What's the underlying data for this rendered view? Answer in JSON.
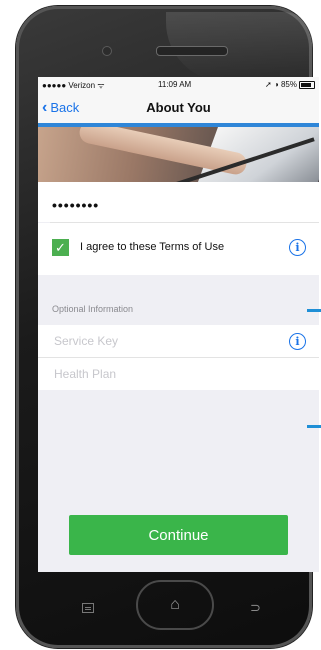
{
  "status_bar": {
    "carrier": "●●●●● Verizon ᯤ",
    "time": "11:09 AM",
    "battery": "85%"
  },
  "nav": {
    "back_label": "Back",
    "title": "About You"
  },
  "form": {
    "password_value": "••••••••",
    "terms_label": "I agree to these Terms of Use",
    "terms_checked": true,
    "optional_header": "Optional Information",
    "service_key_placeholder": "Service Key",
    "health_plan_placeholder": "Health Plan"
  },
  "continue_label": "Continue",
  "colors": {
    "accent_blue": "#2f86d8",
    "button_green": "#3ab54a",
    "checkbox_green": "#4caf50"
  },
  "icons": {
    "back": "chevron-left-icon",
    "info": "info-icon",
    "check": "checkmark-icon",
    "home": "home-icon"
  }
}
